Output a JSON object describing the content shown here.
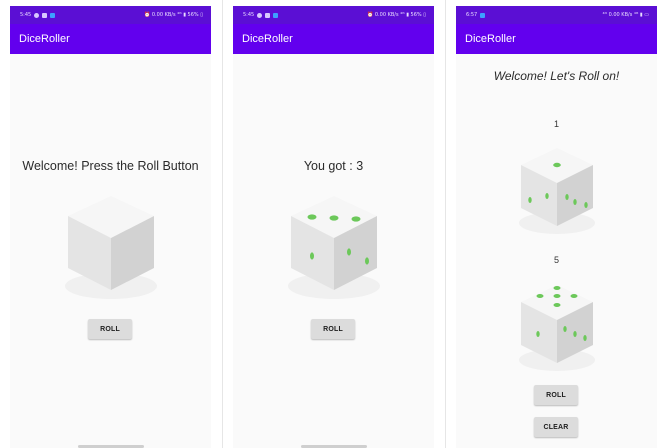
{
  "app": {
    "title": "DiceRoller"
  },
  "screens": [
    {
      "status_time": "5:45",
      "status_right": "⏰ 0.00 KB/s ⁴ᴳ ▮ 56% ▯",
      "message": "Welcome! Press the Roll Button",
      "die_value": null,
      "roll_label": "ROLL"
    },
    {
      "status_time": "5:45",
      "status_right": "⏰ 0.00 KB/s ⁴ᴳ ▮ 56% ▯",
      "message": "You got : 3",
      "die_value": 3,
      "roll_label": "ROLL"
    },
    {
      "status_time": "6:57",
      "status_right": "⁴ᴳ 0.00 KB/s ⁴ᴳ ▮ ▭",
      "message": "Welcome! Let's Roll on!",
      "dice": [
        {
          "label": "1",
          "value": 1
        },
        {
          "label": "5",
          "value": 5
        }
      ],
      "roll_label": "ROLL",
      "clear_label": "CLEAR"
    }
  ],
  "colors": {
    "status_bar": "#5b0fd4",
    "app_bar": "#6200ee",
    "pip": "#6cc85a"
  },
  "icons": [
    "alarm-icon",
    "signal-icon",
    "battery-icon",
    "app-notification-icon"
  ]
}
